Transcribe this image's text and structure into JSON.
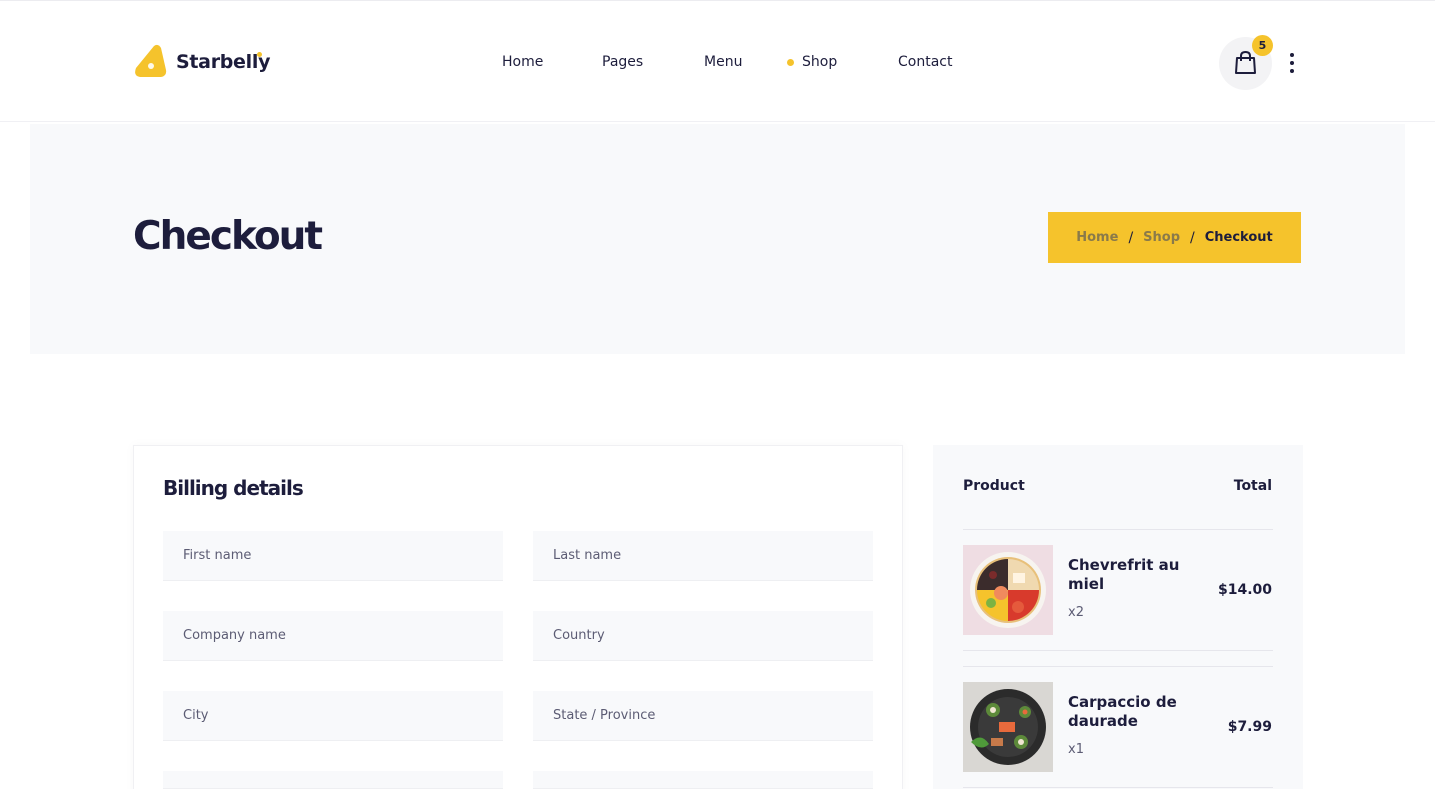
{
  "header": {
    "logo_text": "Starbelly",
    "nav": [
      {
        "label": "Home"
      },
      {
        "label": "Pages"
      },
      {
        "label": "Menu"
      },
      {
        "label": "Shop",
        "active": true
      },
      {
        "label": "Contact"
      }
    ],
    "cart_count": "5",
    "icons": {
      "cart": "shopping-bag-icon",
      "more": "vertical-dots-icon"
    }
  },
  "banner": {
    "title": "Checkout",
    "breadcrumb": {
      "home": "Home",
      "shop": "Shop",
      "current": "Checkout",
      "separator": "/"
    }
  },
  "billing": {
    "title": "Billing details",
    "fields": {
      "first_name": "First name",
      "last_name": "Last name",
      "company": "Company name",
      "country": "Country",
      "city": "City",
      "state": "State / Province"
    }
  },
  "order": {
    "col_product": "Product",
    "col_total": "Total",
    "items": [
      {
        "name": "Chevrefrit au miel",
        "qty": "x2",
        "price": "$14.00"
      },
      {
        "name": "Carpaccio de daurade",
        "qty": "x1",
        "price": "$7.99"
      }
    ]
  },
  "colors": {
    "accent": "#f5c32c",
    "text": "#1d1d3c",
    "panel": "#f8f9fb"
  }
}
